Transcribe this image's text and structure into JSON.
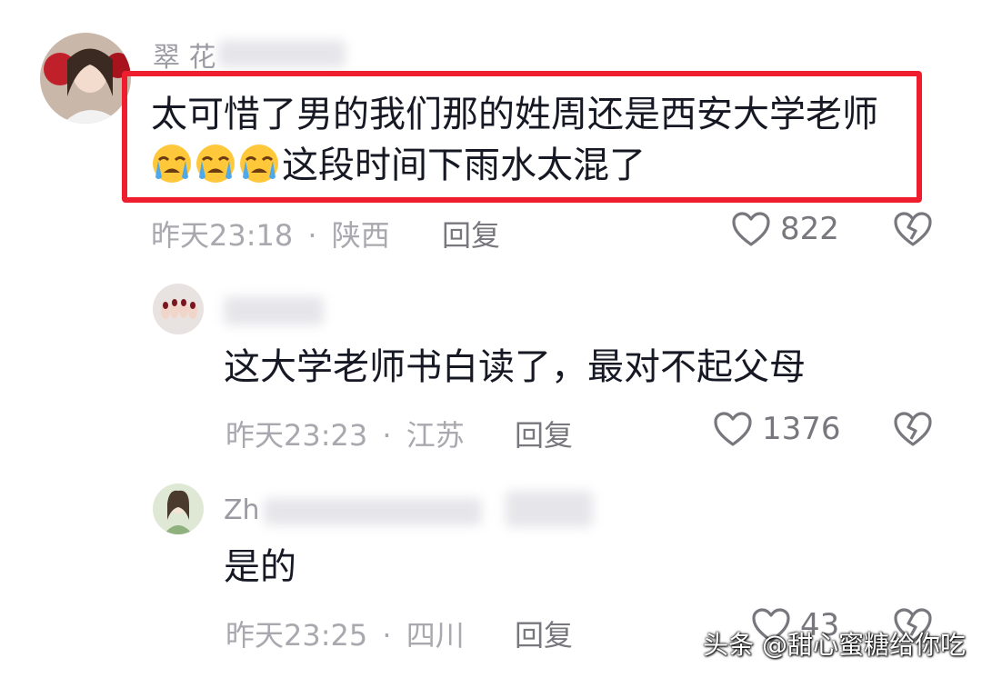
{
  "comments": [
    {
      "username": "翠 花",
      "text_line1": "太可惜了男的我们那的姓周还是西安大学老师",
      "text_line2": "这段时间下雨水太混了",
      "emoji_count": 3,
      "emoji_name": "loudly-crying-face",
      "time": "昨天23:18",
      "sep": "·",
      "location": "陕西",
      "reply_label": "回复",
      "likes": "822",
      "highlighted": true,
      "highlight_color": "#ef1e2e"
    },
    {
      "username": "",
      "text": "这大学老师书白读了，最对不起父母",
      "time": "昨天23:23",
      "sep": "·",
      "location": "江苏",
      "reply_label": "回复",
      "likes": "1376"
    },
    {
      "username": "Zh",
      "text": "是的",
      "time": "昨天23:25",
      "sep": "·",
      "location": "四川",
      "reply_label": "回复",
      "likes": "43"
    }
  ],
  "watermark": "头条 @甜心蜜糖给你吃",
  "icons": {
    "like": "heart-outline-icon",
    "dislike": "broken-heart-icon"
  },
  "colors": {
    "meta_gray": "#a8a8ae",
    "text_dark": "#161823",
    "highlight_red": "#ef1e2e"
  }
}
